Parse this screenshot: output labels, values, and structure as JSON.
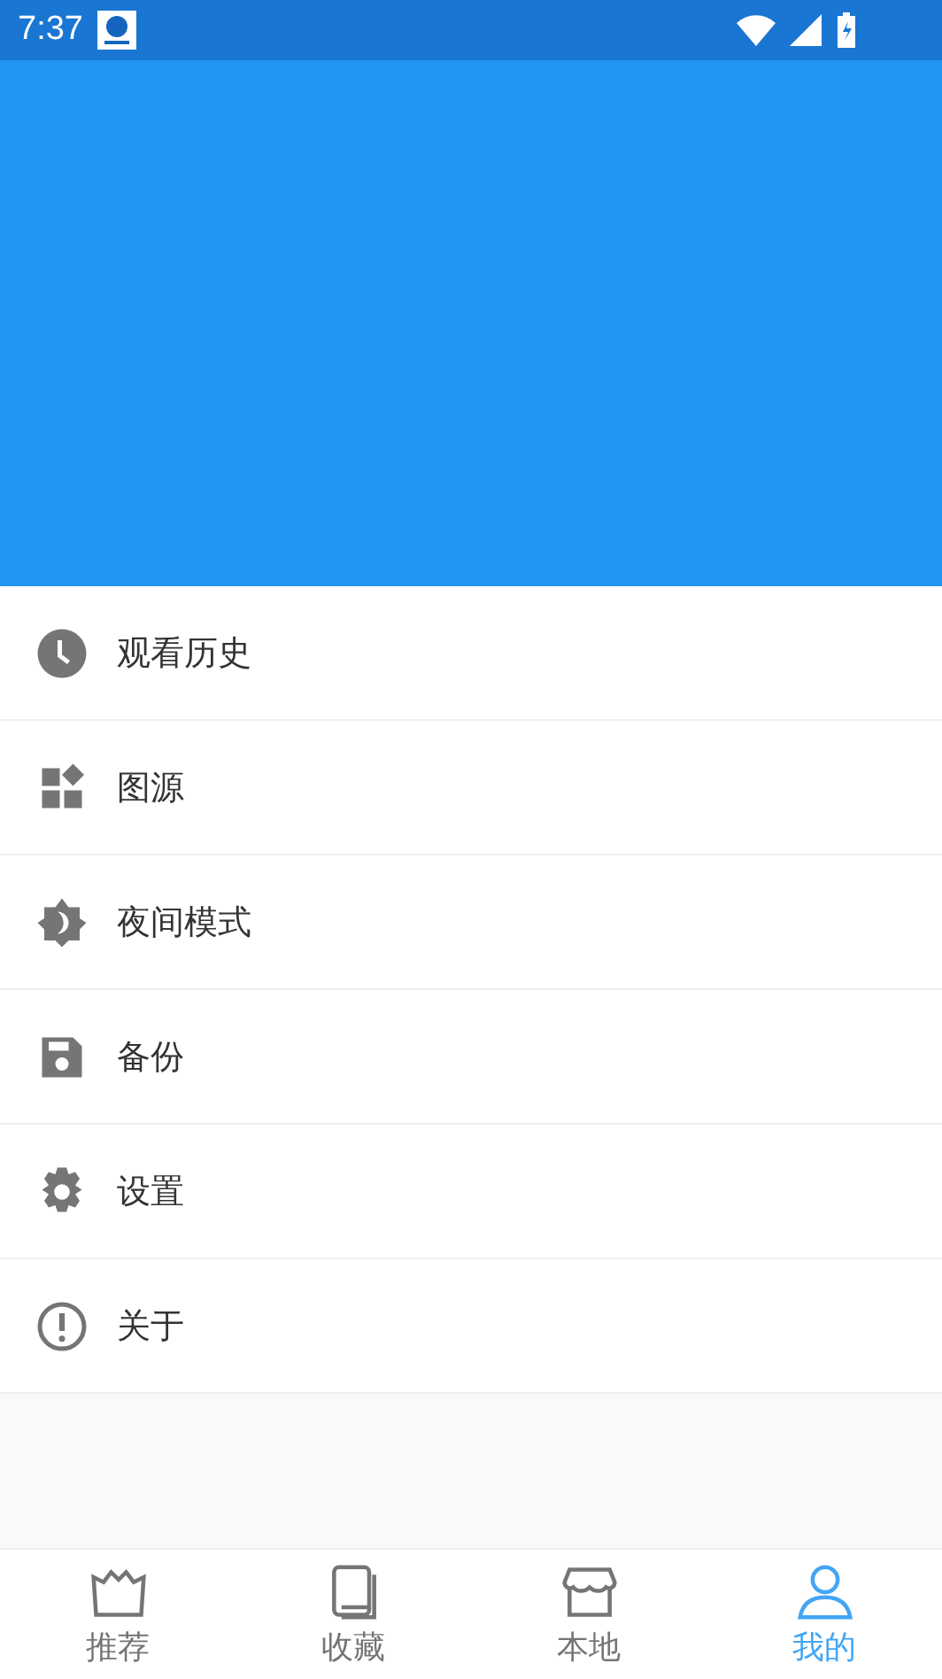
{
  "status_bar": {
    "time": "7:37"
  },
  "menu": [
    {
      "kind": "history",
      "label": "观看历史"
    },
    {
      "kind": "sources",
      "label": "图源"
    },
    {
      "kind": "night",
      "label": "夜间模式"
    },
    {
      "kind": "backup",
      "label": "备份"
    },
    {
      "kind": "settings",
      "label": "设置"
    },
    {
      "kind": "about",
      "label": "关于"
    }
  ],
  "tabs": [
    {
      "kind": "crown",
      "label": "推荐",
      "selected": false
    },
    {
      "kind": "book",
      "label": "收藏",
      "selected": false
    },
    {
      "kind": "store",
      "label": "本地",
      "selected": false
    },
    {
      "kind": "person",
      "label": "我的",
      "selected": true
    }
  ]
}
